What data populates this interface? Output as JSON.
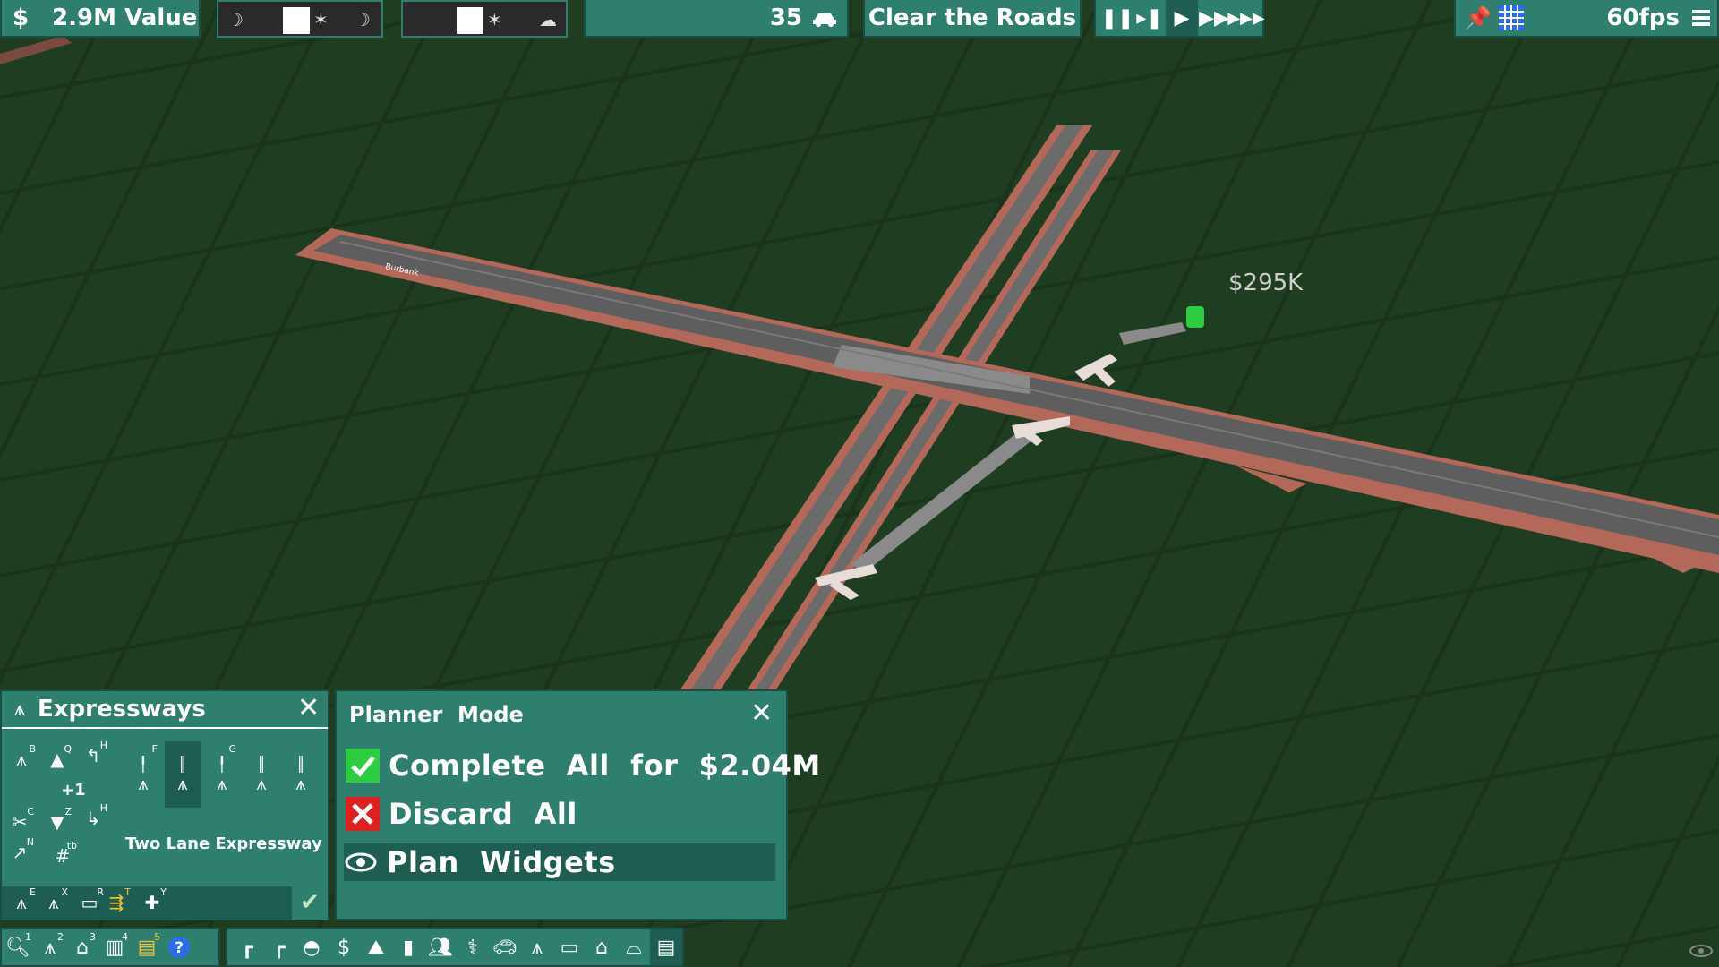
{
  "hud": {
    "value_symbol": "$",
    "value_label": "2.9M Value",
    "vehicle_count": "35",
    "objective": "Clear the Roads",
    "fps": "60fps"
  },
  "world": {
    "price_tag": "$295K",
    "road_sign": "Burbank"
  },
  "expressways_panel": {
    "title": "Expressways",
    "plus_one": "+1",
    "selected_road": "Two Lane Expressway",
    "hotkeys": [
      "B",
      "Q",
      "H",
      "F",
      "G",
      "C",
      "Z",
      "H",
      "N",
      "tb",
      "E",
      "X",
      "R",
      "T",
      "Y"
    ]
  },
  "planner_panel": {
    "title": "Planner  Mode",
    "complete_label": "Complete  All  for  $2.04M",
    "discard_label": "Discard  All",
    "widgets_label": "Plan  Widgets"
  },
  "bottom_bar": {
    "hotkeys": [
      "1",
      "2",
      "3",
      "4",
      "5"
    ]
  },
  "colors": {
    "ui_teal": "#2f7f6f",
    "ui_dark_teal": "#1e5e52",
    "grass": "#1f3d20",
    "road": "#6b6b6b",
    "embankment": "#b4685a",
    "accept_green": "#2ecc40",
    "discard_red": "#e02020",
    "help_blue": "#2a6cf0"
  },
  "icons": [
    "dollar-icon",
    "moon-icon",
    "sun-icon",
    "cloud-icon",
    "car-icon",
    "pause-icon",
    "step-icon",
    "play-icon",
    "fast-icon",
    "fastest-icon",
    "pin-icon",
    "grid-icon",
    "menu-icon",
    "close-icon",
    "check-icon",
    "x-icon",
    "eye-icon",
    "search-icon",
    "question-icon",
    "home-icon"
  ]
}
